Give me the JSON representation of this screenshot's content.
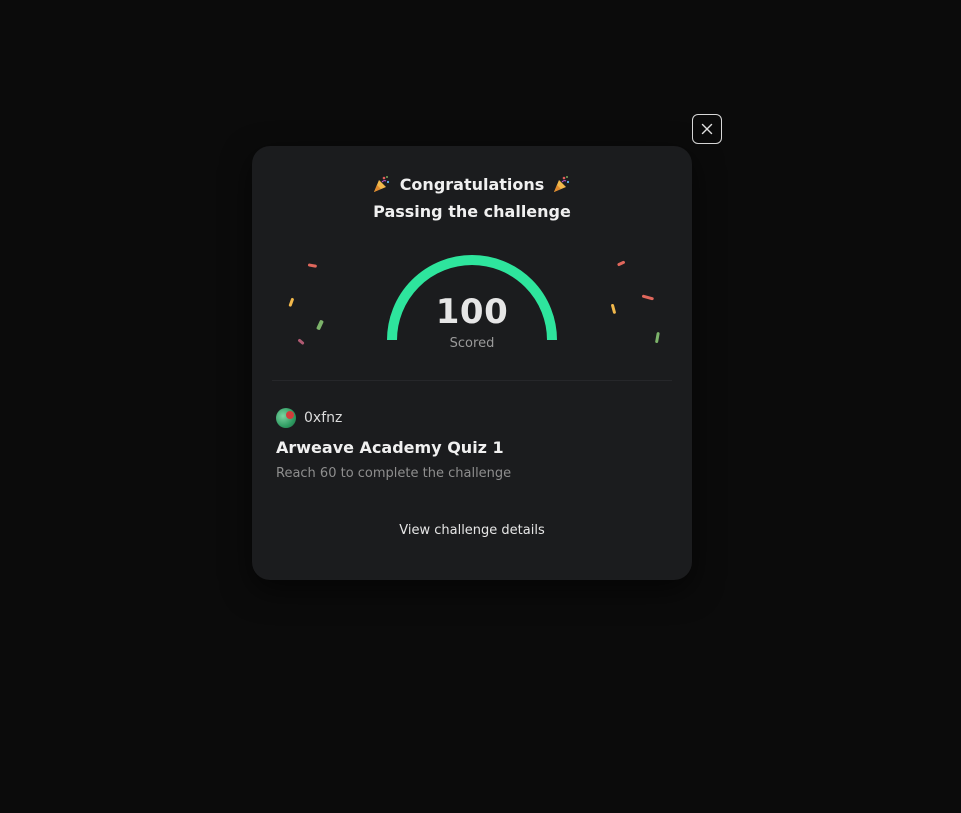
{
  "modal": {
    "title": "Congratulations",
    "subtitle": "Passing the challenge",
    "score": {
      "value": "100",
      "label": "Scored",
      "fraction": 1.0,
      "color": "#2ee59d"
    },
    "user": {
      "name": "0xfnz"
    },
    "challenge": {
      "title": "Arweave Academy Quiz 1",
      "description": "Reach 60 to complete the challenge"
    },
    "details_link": "View challenge details"
  },
  "icons": {
    "close": "close-icon",
    "party": "party-popper-icon",
    "avatar": "avatar"
  },
  "colors": {
    "background": "#0b0b0b",
    "card": "#1b1c1e",
    "accent": "#2ee59d"
  }
}
